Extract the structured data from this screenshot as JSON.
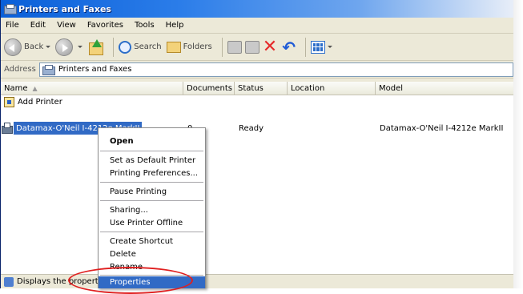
{
  "window": {
    "title": "Printers and Faxes"
  },
  "menubar": [
    "File",
    "Edit",
    "View",
    "Favorites",
    "Tools",
    "Help"
  ],
  "toolbar": {
    "back": "Back",
    "search": "Search",
    "folders": "Folders"
  },
  "address": {
    "label": "Address",
    "value": "Printers and Faxes"
  },
  "columns": [
    "Name",
    "Documents",
    "Status",
    "Location",
    "Model"
  ],
  "items": {
    "add_printer": "Add Printer",
    "printer": {
      "name": "Datamax-O'Neil I-4212e MarkII",
      "documents": "0",
      "status": "Ready",
      "location": "",
      "model": "Datamax-O'Neil I-4212e MarkII"
    }
  },
  "statusbar": {
    "text": "Displays the properties of the selected items."
  },
  "context_menu": {
    "open": "Open",
    "set_default": "Set as Default Printer",
    "preferences": "Printing Preferences...",
    "pause": "Pause Printing",
    "sharing": "Sharing...",
    "offline": "Use Printer Offline",
    "shortcut": "Create Shortcut",
    "delete": "Delete",
    "rename": "Rename",
    "properties": "Properties"
  },
  "colors": {
    "selection": "#316ac5",
    "annotation": "#e02020",
    "chrome": "#ece9d8"
  }
}
